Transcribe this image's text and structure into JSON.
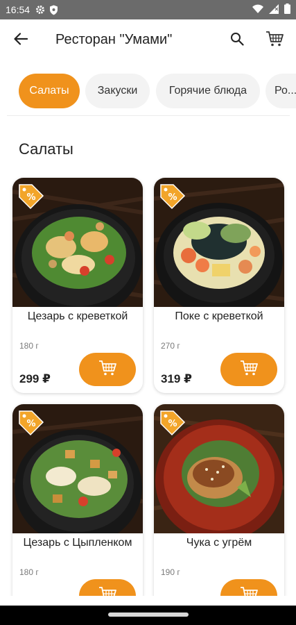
{
  "status_bar": {
    "time": "16:54",
    "icons": [
      "gear-icon",
      "shield-icon",
      "wifi-icon",
      "signal-icon",
      "battery-icon"
    ]
  },
  "app_bar": {
    "title": "Ресторан \"Умами\"",
    "icons": [
      "back-arrow-icon",
      "search-icon",
      "cart-icon"
    ]
  },
  "tabs": [
    {
      "label": "Салаты",
      "active": true
    },
    {
      "label": "Закуски",
      "active": false
    },
    {
      "label": "Горячие блюда",
      "active": false
    },
    {
      "label": "Ро...",
      "active": false
    }
  ],
  "section": {
    "title": "Салаты"
  },
  "products": [
    {
      "name": "Цезарь с креветкой",
      "weight": "180 г",
      "price": "299 ₽",
      "badge": "discount-tag-icon"
    },
    {
      "name": "Поке с креветкой",
      "weight": "270 г",
      "price": "319 ₽",
      "badge": "discount-tag-icon"
    },
    {
      "name": "Цезарь с Цыпленком",
      "weight": "180 г",
      "price": "",
      "badge": "discount-tag-icon"
    },
    {
      "name": "Чука с угрём",
      "weight": "190 г",
      "price": "",
      "badge": "discount-tag-icon"
    }
  ],
  "colors": {
    "accent": "#f0921c",
    "status_bar": "#6b6b6b",
    "tab_inactive": "#f3f3f3"
  }
}
